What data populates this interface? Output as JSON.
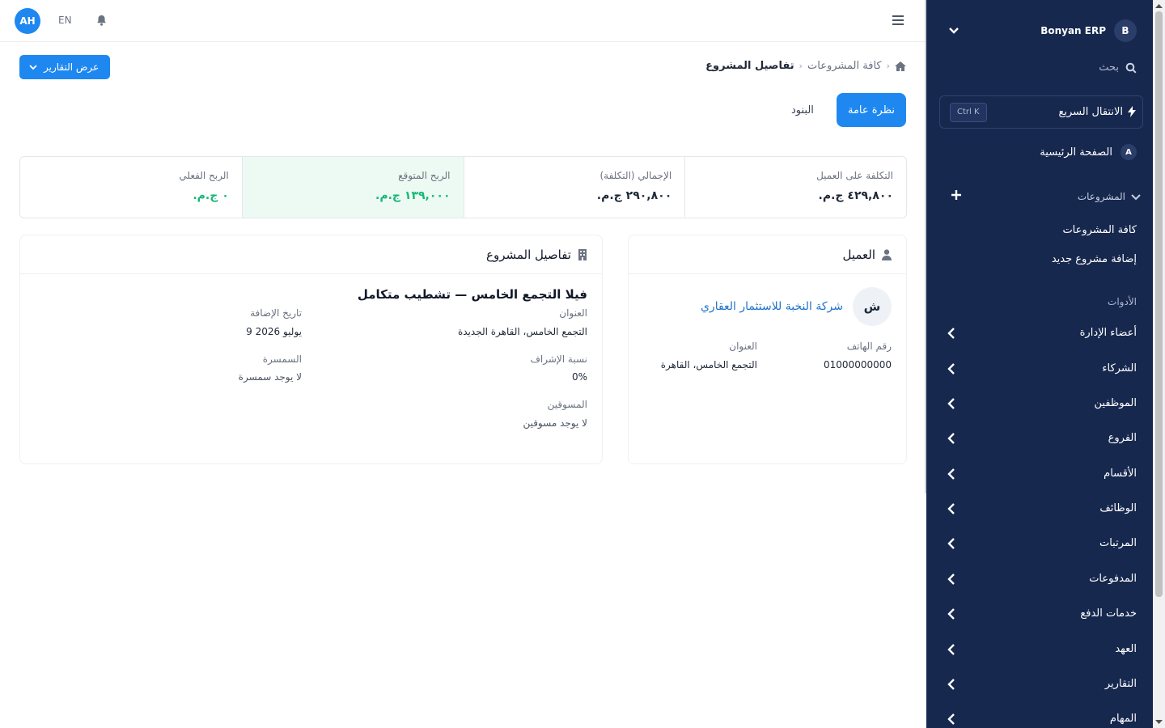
{
  "sidebar": {
    "brand_badge": "B",
    "brand_name": "Bonyan ERP",
    "search_label": "بحث",
    "quick_jump_label": "الانتقال السريع",
    "quick_jump_shortcut": "Ctrl K",
    "home_badge": "A",
    "home_label": "الصفحة الرئيسية",
    "projects_label": "المشروعات",
    "projects_sub": [
      "كافة المشروعات",
      "إضافة مشروع جديد"
    ],
    "tools_label": "الأدوات",
    "items": [
      "أعضاء الإدارة",
      "الشركاء",
      "الموظفين",
      "الفروع",
      "الأقسام",
      "الوظائف",
      "المرتبات",
      "المدفوعات",
      "خدمات الدفع",
      "العهد",
      "التقارير",
      "المهام"
    ]
  },
  "topbar": {
    "avatar_initials": "AH",
    "language": "EN"
  },
  "breadcrumb": {
    "link": "كافة المشروعات",
    "current": "تفاصيل المشروع"
  },
  "reports_button": "عرض التقارير",
  "tabs": {
    "overview": "نظرة عامة",
    "items": "البنود"
  },
  "stats": [
    {
      "label": "التكلفة على العميل",
      "value": "٤٢٩,٨٠٠ ج.م."
    },
    {
      "label": "الإجمالي (التكلفة)",
      "value": "٢٩٠,٨٠٠ ج.م."
    },
    {
      "label": "الربح المتوقع",
      "value": "١٣٩,٠٠٠ ج.م."
    },
    {
      "label": "الربح الفعلي",
      "value": "٠ ج.م."
    }
  ],
  "client_card": {
    "title": "العميل",
    "badge": "ش",
    "name": "شركة النخبة للاستثمار العقاري",
    "phone_label": "رقم الهاتف",
    "phone_value": "01000000000",
    "address_label": "العنوان",
    "address_value": "التجمع الخامس، القاهرة"
  },
  "project_card": {
    "title": "تفاصيل المشروع",
    "name": "فيلا التجمع الخامس — تشطيب متكامل",
    "address_label": "العنوان",
    "address_value": "التجمع الخامس، القاهرة الجديدة",
    "date_label": "تاريخ الإضافة",
    "date_value": "9 يوليو 2026",
    "supervision_label": "نسبة الإشراف",
    "supervision_value": "0%",
    "brokerage_label": "السمسرة",
    "brokerage_value": "لا يوجد سمسرة",
    "marketers_label": "المسوقين",
    "marketers_value": "لا يوجد مسوقين"
  },
  "colors": {
    "sidebar_bg": "#17284f",
    "accent": "#1e88f0",
    "success": "#16b877",
    "highlight_bg": "#edfaf3"
  },
  "icons": [
    "bell-icon",
    "menu-icon",
    "home-icon",
    "search-icon",
    "bolt-icon",
    "chevron-down-icon",
    "chevron-left-icon",
    "plus-icon",
    "user-icon",
    "building-icon"
  ]
}
